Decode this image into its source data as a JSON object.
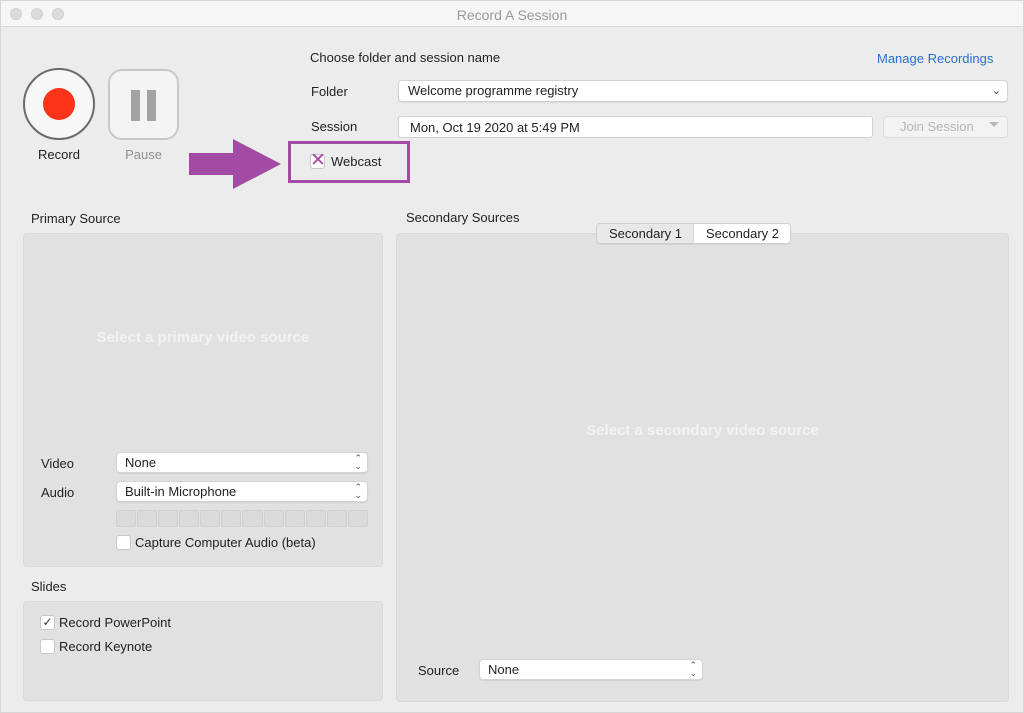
{
  "window": {
    "title": "Record A Session"
  },
  "controls": {
    "record_label": "Record",
    "pause_label": "Pause"
  },
  "session_form": {
    "heading": "Choose folder and session name",
    "manage_recordings_link": "Manage Recordings",
    "folder_label": "Folder",
    "folder_value": "Welcome programme registry",
    "session_label": "Session",
    "session_value": "Mon, Oct 19 2020 at 5:49 PM",
    "join_session_label": "Join Session",
    "webcast_label": "Webcast",
    "webcast_mark": "✕"
  },
  "primary_source": {
    "title": "Primary Source",
    "placeholder": "Select a primary video source",
    "video_label": "Video",
    "video_value": "None",
    "audio_label": "Audio",
    "audio_value": "Built-in Microphone",
    "audio_meter_segments": 12,
    "audio_level": 0,
    "capture_computer_audio_label": "Capture Computer Audio (beta)",
    "capture_computer_audio_checked": false
  },
  "slides": {
    "title": "Slides",
    "record_powerpoint_label": "Record PowerPoint",
    "record_powerpoint_checked": true,
    "record_keynote_label": "Record Keynote",
    "record_keynote_checked": false,
    "check_glyph": "✓"
  },
  "secondary_sources": {
    "title": "Secondary Sources",
    "tabs": [
      {
        "label": "Secondary 1",
        "selected": false
      },
      {
        "label": "Secondary 2",
        "selected": true
      }
    ],
    "placeholder": "Select a secondary video source",
    "source_label": "Source",
    "source_value": "None"
  },
  "colors": {
    "record_red": "#fb3319",
    "link_blue": "#2a6fd6",
    "annotation_purple": "#a24aa4"
  }
}
